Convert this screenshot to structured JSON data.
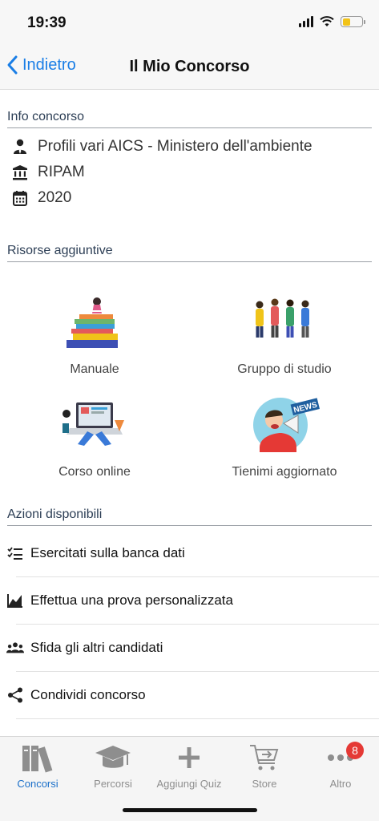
{
  "status": {
    "time": "19:39",
    "battery_level": 0.35,
    "battery_color": "#f2c318"
  },
  "nav": {
    "back_label": "Indietro",
    "title": "Il Mio Concorso",
    "accent": "#1a7ee6"
  },
  "info": {
    "header": "Info concorso",
    "items": [
      {
        "icon": "person-icon",
        "text": "Profili vari AICS - Ministero dell'ambiente"
      },
      {
        "icon": "institution-icon",
        "text": "RIPAM"
      },
      {
        "icon": "calendar-icon",
        "text": "2020"
      }
    ]
  },
  "resources": {
    "header": "Risorse aggiuntive",
    "items": [
      {
        "icon": "books-illustration",
        "label": "Manuale"
      },
      {
        "icon": "students-illustration",
        "label": "Gruppo di studio"
      },
      {
        "icon": "laptop-illustration",
        "label": "Corso online"
      },
      {
        "icon": "news-megaphone-illustration",
        "label": "Tienimi aggiornato",
        "badge_text": "NEWS"
      }
    ]
  },
  "actions": {
    "header": "Azioni disponibili",
    "items": [
      {
        "icon": "checklist-icon",
        "label": "Esercitati sulla banca dati"
      },
      {
        "icon": "chart-icon",
        "label": "Effettua una prova personalizzata"
      },
      {
        "icon": "group-icon",
        "label": "Sfida gli altri candidati"
      },
      {
        "icon": "share-icon",
        "label": "Condividi concorso"
      }
    ]
  },
  "tabs": [
    {
      "icon": "books-icon",
      "label": "Concorsi",
      "active": true
    },
    {
      "icon": "graduation-cap-icon",
      "label": "Percorsi"
    },
    {
      "icon": "plus-icon",
      "label": "Aggiungi Quiz"
    },
    {
      "icon": "cart-icon",
      "label": "Store"
    },
    {
      "icon": "more-icon",
      "label": "Altro",
      "badge": "8"
    }
  ]
}
